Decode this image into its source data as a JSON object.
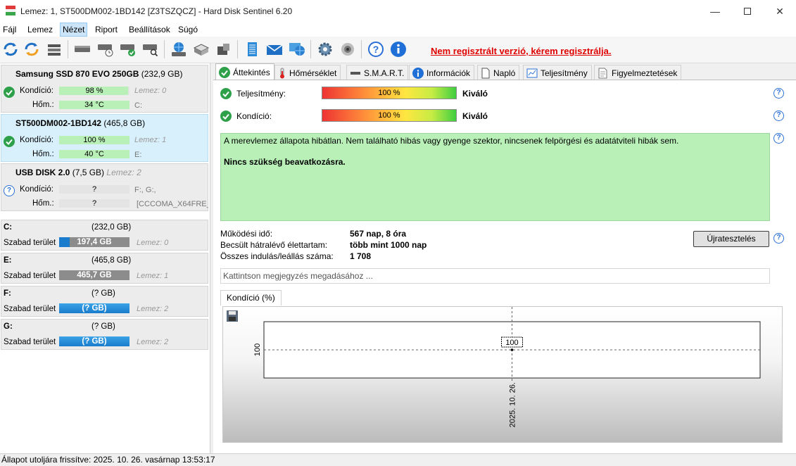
{
  "window": {
    "title": "Lemez: 1, ST500DM002-1BD142 [Z3TSZQCZ]  -  Hard Disk Sentinel 6.20"
  },
  "menu": [
    {
      "label": "Fájl"
    },
    {
      "label": "Lemez"
    },
    {
      "label": "Nézet"
    },
    {
      "label": "Riport"
    },
    {
      "label": "Beállítások"
    },
    {
      "label": "Súgó"
    }
  ],
  "toolbar": {
    "unregistered_text": "Nem regisztrált verzió, kérem regisztrálja."
  },
  "disks": [
    {
      "name": "Samsung SSD 870 EVO 250GB",
      "size": "(232,9 GB)",
      "disk_label": "",
      "condition_label": "Kondíció:",
      "condition_value": "98 %",
      "condition_level": 0.98,
      "temp_label": "Hőm.:",
      "temp_value": "34 °C",
      "lemez": "Lemez: 0",
      "drives": "C:",
      "status": "ok"
    },
    {
      "name": "ST500DM002-1BD142",
      "size": "(465,8 GB)",
      "disk_label": "",
      "condition_label": "Kondíció:",
      "condition_value": "100 %",
      "condition_level": 1.0,
      "temp_label": "Hőm.:",
      "temp_value": "40 °C",
      "lemez": "Lemez: 1",
      "drives": "E:",
      "status": "ok"
    },
    {
      "name": "USB DISK 2.0",
      "size": "(7,5 GB)",
      "disk_label": "Lemez: 2",
      "condition_label": "Kondíció:",
      "condition_value": "?",
      "temp_label": "Hőm.:",
      "temp_value": "?",
      "lemez": "",
      "drives": "F:, G:,",
      "extra": "[CCCOMA_X64FRE_",
      "status": "unknown"
    }
  ],
  "volumes": [
    {
      "letter": "C:",
      "size": "(232,0 GB)",
      "free_label": "Szabad terület",
      "free": "197,4 GB",
      "free_level": 0.15,
      "lemez": "Lemez: 0"
    },
    {
      "letter": "E:",
      "size": "(465,8 GB)",
      "free_label": "Szabad terület",
      "free": "465,7 GB",
      "lemez": "Lemez: 1"
    },
    {
      "letter": "F:",
      "size": "(? GB)",
      "free_label": "Szabad terület",
      "free": "(? GB)",
      "lemez": "Lemez: 2"
    },
    {
      "letter": "G:",
      "size": "(? GB)",
      "free_label": "Szabad terület",
      "free": "(? GB)",
      "lemez": "Lemez: 2"
    }
  ],
  "tabs": [
    {
      "label": "Áttekintés"
    },
    {
      "label": "Hőmérséklet"
    },
    {
      "label": "S.M.A.R.T."
    },
    {
      "label": "Információk"
    },
    {
      "label": "Napló"
    },
    {
      "label": "Teljesítmény"
    },
    {
      "label": "Figyelmeztetések"
    }
  ],
  "overview": {
    "performance_label": "Teljesítmény:",
    "performance_value": "100 %",
    "performance_rating": "Kiváló",
    "condition_label": "Kondíció:",
    "condition_value": "100 %",
    "condition_rating": "Kiváló",
    "summary_text": "A merevlemez állapota hibátlan. Nem található hibás vagy gyenge szektor, nincsenek felpörgési és adatátviteli hibák sem.",
    "summary_action": "Nincs szükség beavatkozásra.",
    "uptime_label": "Működési idő:",
    "uptime_value": "567 nap, 8 óra",
    "lifetime_label": "Becsült hátralévő élettartam:",
    "lifetime_value": "több mint 1000 nap",
    "starts_label": "Összes indulás/leállás száma:",
    "starts_value": "1 708",
    "retest_button": "Újratesztelés",
    "note_placeholder": "Kattintson megjegyzés megadásához ...",
    "chart_tab": "Kondíció  (%)"
  },
  "chart_data": {
    "type": "line",
    "x": [
      "2025. 10. 26."
    ],
    "series": [
      {
        "values": [
          100
        ]
      }
    ],
    "y_tick": "100",
    "data_label": "100"
  },
  "statusbar": {
    "text": "Állapot utoljára frissítve: 2025. 10. 26. vasárnap 13:53:17"
  }
}
